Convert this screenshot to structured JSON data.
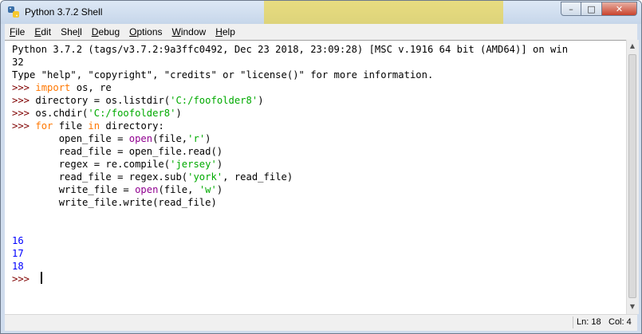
{
  "window": {
    "title": "Python 3.7.2 Shell",
    "min_glyph": "–",
    "max_glyph": "□",
    "close_glyph": "✕"
  },
  "menu": [
    {
      "label": "File",
      "u": "F",
      "rest": "ile"
    },
    {
      "label": "Edit",
      "u": "E",
      "rest": "dit"
    },
    {
      "label": "Shell",
      "pre": "She",
      "u": "l",
      "rest": "l"
    },
    {
      "label": "Debug",
      "u": "D",
      "rest": "ebug"
    },
    {
      "label": "Options",
      "u": "O",
      "rest": "ptions"
    },
    {
      "label": "Window",
      "u": "W",
      "rest": "indow"
    },
    {
      "label": "Help",
      "u": "H",
      "rest": "elp"
    }
  ],
  "shell": {
    "banner1": "Python 3.7.2 (tags/v3.7.2:9a3ffc0492, Dec 23 2018, 23:09:28) [MSC v.1916 64 bit (AMD64)] on win",
    "banner2": "32",
    "banner3": "Type \"help\", \"copyright\", \"credits\" or \"license()\" for more information.",
    "prompt": ">>> ",
    "cmd1_kw": "import",
    "cmd1_rest": " os, re",
    "cmd2_pre": "directory = os.listdir(",
    "cmd2_str": "'C:/foofolder8'",
    "cmd2_post": ")",
    "cmd3_pre": "os.chdir(",
    "cmd3_str": "'C:/foofolder8'",
    "cmd3_post": ")",
    "cmd4_kw1": "for",
    "cmd4_mid": " file ",
    "cmd4_kw2": "in",
    "cmd4_post": " directory:",
    "b1_pre": "        open_file = ",
    "b1_bi": "open",
    "b1_mid": "(file,",
    "b1_str": "'r'",
    "b1_post": ")",
    "b2": "        read_file = open_file.read()",
    "b3_pre": "        regex = re.compile(",
    "b3_str": "'jersey'",
    "b3_post": ")",
    "b4_pre": "        read_file = regex.sub(",
    "b4_str": "'york'",
    "b4_post": ", read_file)",
    "b5_pre": "        write_file = ",
    "b5_bi": "open",
    "b5_mid": "(file, ",
    "b5_str": "'w'",
    "b5_post": ")",
    "b6": "        write_file.write(read_file)",
    "out1": "16",
    "out2": "17",
    "out3": "18",
    "final_prompt": ">>> "
  },
  "status": {
    "ln": "Ln: 18",
    "col": "Col: 4"
  }
}
